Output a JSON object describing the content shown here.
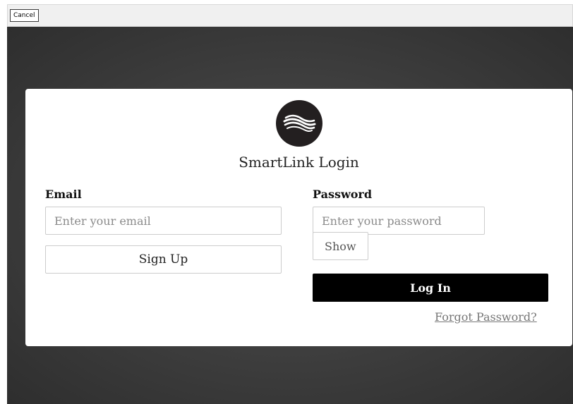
{
  "window": {
    "cancel_label": "Cancel"
  },
  "login": {
    "logo_icon": "waves-logo-icon",
    "title": "SmartLink Login",
    "email": {
      "label": "Email",
      "placeholder": "Enter your email",
      "value": ""
    },
    "password": {
      "label": "Password",
      "placeholder": "Enter your password",
      "value": "",
      "show_label": "Show"
    },
    "signup_label": "Sign Up",
    "login_label": "Log In",
    "forgot_label": "Forgot Password?"
  },
  "colors": {
    "card_bg": "#ffffff",
    "primary_button": "#000000",
    "logo_circle": "#231f20",
    "backdrop": "#404040"
  }
}
